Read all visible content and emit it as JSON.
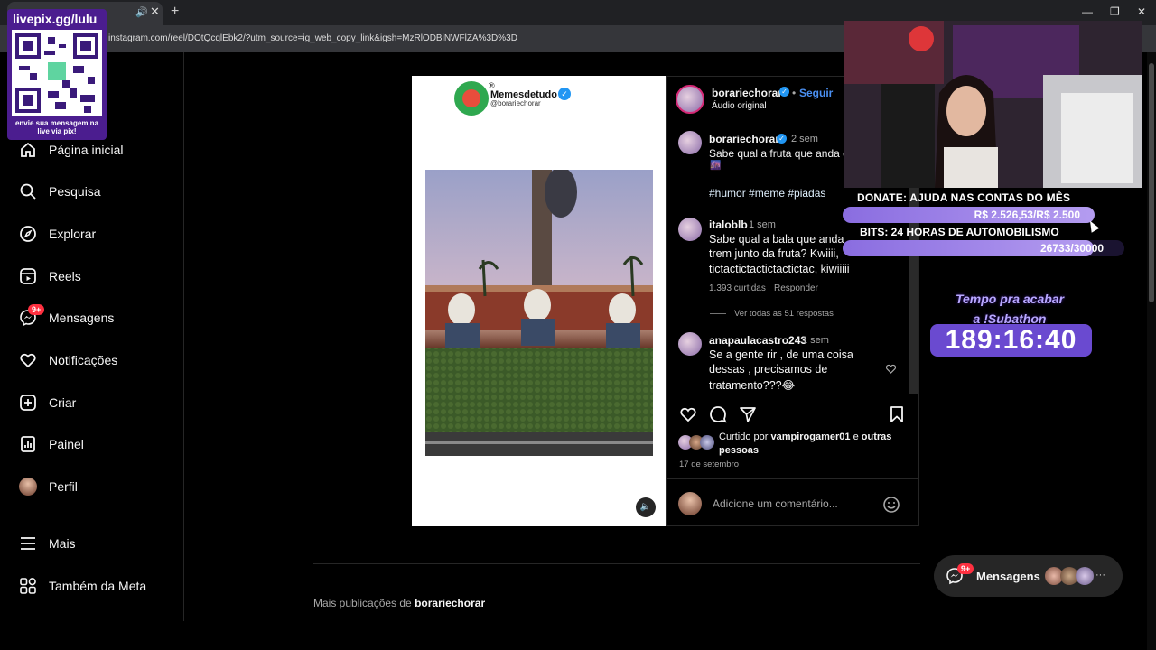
{
  "browser": {
    "tab_audio_icon": "speaker-icon",
    "tab_close": "✕",
    "new_tab": "+",
    "url": "instagram.com/reel/DOtQcqlEbk2/?utm_source=ig_web_copy_link&igsh=MzRlODBiNWFlZA%3D%3D",
    "controls": {
      "minimize": "—",
      "restore": "❐",
      "close": "✕"
    }
  },
  "overlay_qr": {
    "title": "livepix.gg/lulu",
    "caption": "envie sua mensagem na live via pix!"
  },
  "sidebar": {
    "items": [
      {
        "label": "Página inicial",
        "icon": "home-icon"
      },
      {
        "label": "Pesquisa",
        "icon": "search-icon"
      },
      {
        "label": "Explorar",
        "icon": "compass-icon"
      },
      {
        "label": "Reels",
        "icon": "reels-icon"
      },
      {
        "label": "Mensagens",
        "icon": "messenger-icon",
        "badge": "9+"
      },
      {
        "label": "Notificações",
        "icon": "heart-icon"
      },
      {
        "label": "Criar",
        "icon": "plus-square-icon"
      },
      {
        "label": "Painel",
        "icon": "dashboard-icon"
      },
      {
        "label": "Perfil",
        "icon": "profile-avatar"
      },
      {
        "label": "Mais",
        "icon": "menu-icon"
      },
      {
        "label": "Também da Meta",
        "icon": "meta-apps-icon"
      }
    ]
  },
  "media": {
    "meme_brand": "Memesdetudo",
    "meme_reg": "®",
    "meme_handle": "@borariechorar",
    "mute_icon": "speaker-icon"
  },
  "post": {
    "author": "borariechorar",
    "follow": "Seguir",
    "audio": "Áudio original",
    "caption_author": "borariechorar",
    "caption_time": "2 sem",
    "caption_text": "Sabe qual a fruta que anda d",
    "hashtags": "#humor #meme #piadas",
    "comments": [
      {
        "user": "italoblb",
        "time": "1 sem",
        "lines": [
          "Sabe qual a bala que anda",
          "trem junto da fruta? Kwiiii,",
          "tictactictactictactictac, kiwiiiii"
        ],
        "likes": "1.393 curtidas",
        "reply": "Responder",
        "view_replies": "Ver todas as 51 respostas"
      },
      {
        "user": "anapaulacastro243",
        "time": "1 sem",
        "lines": [
          "Se a gente rir , de uma coisa",
          "dessas , precisamos de",
          "tratamento???😂"
        ]
      }
    ],
    "liked_prefix": "Curtido por",
    "liked_user": "vampirogamer01",
    "liked_and": "e",
    "liked_others": "outras",
    "liked_others_2": "pessoas",
    "date": "17 de setembro",
    "comment_placeholder": "Adicione um comentário..."
  },
  "stream_overlay": {
    "donate_title": "DONATE: AJUDA NAS CONTAS DO MÊS",
    "donate_value": "R$ 2.526,53/R$ 2.500",
    "donate_progress": 1.0,
    "bits_title": "BITS: 24 HORAS DE AUTOMOBILISMO",
    "bits_value": "26733/30000",
    "bits_progress": 0.891,
    "tempo_line1": "Tempo pra acabar",
    "tempo_line2": "a !Subathon",
    "timer": "189:16:40"
  },
  "footer": {
    "more_prefix": "Mais publicações de",
    "more_user": "borariechorar"
  },
  "messages_pill": {
    "label": "Mensagens",
    "badge": "9+",
    "more": "···"
  },
  "colors": {
    "background": "#000000",
    "link": "#e0f1ff",
    "verified": "#2196f3",
    "badge": "#ff3040",
    "overlay_purple": "#6a4ad0"
  }
}
